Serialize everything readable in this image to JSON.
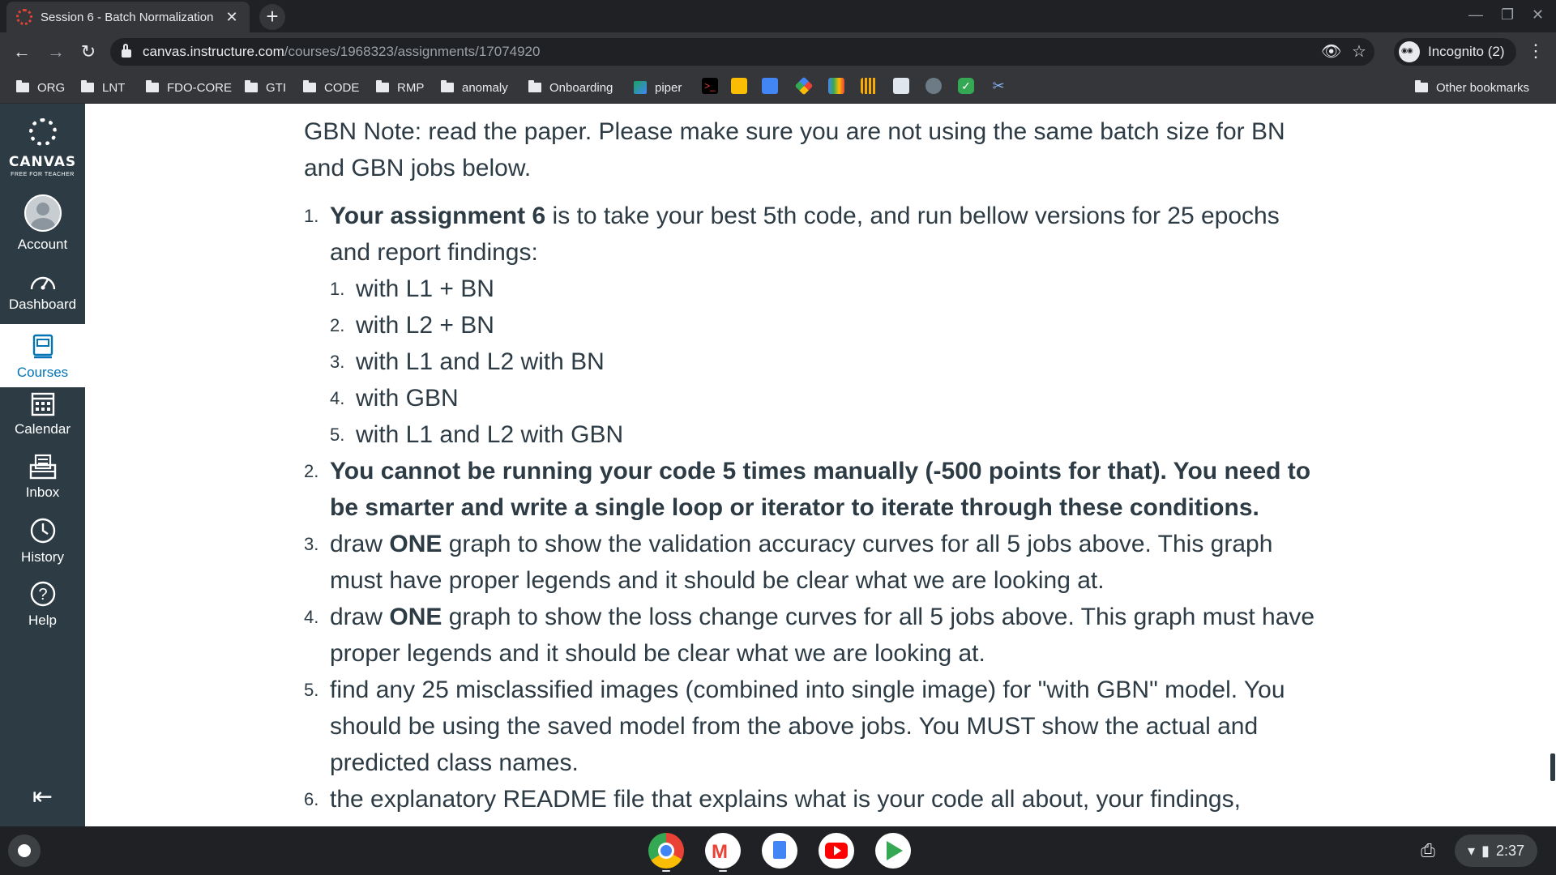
{
  "browser": {
    "tab_title": "Session 6 - Batch Normalization",
    "tab_close": "✕",
    "new_tab": "+",
    "url_host": "canvas.instructure.com",
    "url_path": "/courses/1968323/assignments/17074920",
    "profile_label": "Incognito (2)",
    "bookmarks": [
      {
        "label": "ORG"
      },
      {
        "label": "LNT"
      },
      {
        "label": "FDO-CORE"
      },
      {
        "label": "GTI"
      },
      {
        "label": "CODE"
      },
      {
        "label": "RMP"
      },
      {
        "label": "anomaly"
      },
      {
        "label": "Onboarding"
      },
      {
        "label": "piper"
      }
    ],
    "other_bookmarks": "Other bookmarks"
  },
  "canvas_nav": {
    "logo_text": "CANVAS",
    "logo_sub": "FREE FOR TEACHER",
    "items": [
      {
        "label": "Account",
        "icon": "avatar"
      },
      {
        "label": "Dashboard",
        "icon": "dashboard-icon"
      },
      {
        "label": "Courses",
        "icon": "courses-icon",
        "active": true
      },
      {
        "label": "Calendar",
        "icon": "calendar-icon"
      },
      {
        "label": "Inbox",
        "icon": "inbox-icon"
      },
      {
        "label": "History",
        "icon": "history-icon"
      },
      {
        "label": "Help",
        "icon": "help-icon"
      }
    ],
    "collapse_icon": "collapse-nav-icon"
  },
  "content": {
    "note": "GBN Note: read the paper. Please make sure you are not using the same batch size for BN and GBN jobs below.",
    "items": [
      {
        "num": "1.",
        "bold": "Your assignment 6",
        "text": " is to take your best 5th code, and run bellow versions for 25 epochs and report findings:",
        "sub": [
          {
            "num": "1.",
            "text": "with L1 + BN"
          },
          {
            "num": "2.",
            "text": "with L2 + BN"
          },
          {
            "num": "3.",
            "text": "with L1 and L2 with BN"
          },
          {
            "num": "4.",
            "text": "with GBN"
          },
          {
            "num": "5.",
            "text": "with L1 and L2 with GBN"
          }
        ]
      },
      {
        "num": "2.",
        "bold": "You cannot be running your code 5 times manually (-500 points for that). You need to be smarter and write a single loop or iterator to iterate through these conditions."
      },
      {
        "num": "3.",
        "pre": "draw ",
        "bold": "ONE",
        "text": " graph to show the validation accuracy curves for all 5 jobs above. This graph must have proper legends and it should be clear what we are looking at."
      },
      {
        "num": "4.",
        "pre": "draw ",
        "bold": "ONE",
        "text": " graph to show the loss change curves for all 5 jobs above. This graph must have proper legends and it should be clear what we are looking at."
      },
      {
        "num": "5.",
        "text": "find any 25 misclassified images (combined into single image) for \"with GBN\" model. You should be using the saved model from the above jobs.  You MUST show the actual and predicted class names."
      },
      {
        "num": "6.",
        "text": "the explanatory README file that explains what is your code all about, your findings,"
      }
    ]
  },
  "shelf": {
    "apps": [
      "chrome-icon",
      "gmail-icon",
      "docs-icon",
      "youtube-icon",
      "play-store-icon"
    ],
    "time": "2:37"
  }
}
